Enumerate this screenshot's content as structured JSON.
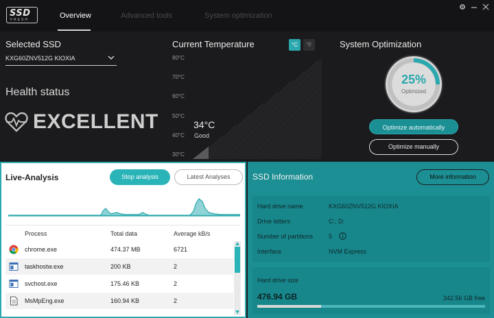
{
  "app": {
    "logo_main": "SSD",
    "logo_sub": "FRESH"
  },
  "tabs": [
    {
      "label": "Overview",
      "active": true
    },
    {
      "label": "Advanced tools",
      "active": false
    },
    {
      "label": "System optimization",
      "active": false
    }
  ],
  "window": {
    "icons": [
      "gear-icon",
      "minimize-icon",
      "close-icon"
    ]
  },
  "selected_ssd": {
    "title": "Selected SSD",
    "value": "KXG60ZNV512G KIOXIA"
  },
  "health": {
    "label": "Health status",
    "value": "EXCELLENT",
    "icon": "heartbeat-icon"
  },
  "temperature": {
    "title": "Current Temperature",
    "unit_c": "°C",
    "unit_f": "°F",
    "active_unit": "C",
    "ticks": [
      "80°C",
      "70°C",
      "60°C",
      "50°C",
      "40°C",
      "30°C"
    ],
    "value": "34°C",
    "status": "Good",
    "range": [
      30,
      80
    ],
    "level": 34
  },
  "optimization": {
    "title": "System Optimization",
    "percent_label": "25%",
    "percent": 25,
    "sub_label": "Optimized",
    "btn_auto": "Optimize automatically",
    "btn_manual": "Optimize manually"
  },
  "live": {
    "title": "Live-Analysis",
    "btn_stop": "Stop analysis",
    "btn_latest": "Latest Analyses",
    "columns": [
      "Process",
      "Total data",
      "Average kB/s"
    ],
    "rows": [
      {
        "icon": "chrome-icon",
        "process": "chrome.exe",
        "total": "474.37 MB",
        "avg": "6721"
      },
      {
        "icon": "app-window-icon",
        "process": "taskhostw.exe",
        "total": "200 KB",
        "avg": "2"
      },
      {
        "icon": "app-window-icon",
        "process": "svchost.exe",
        "total": "175.46 KB",
        "avg": "2"
      },
      {
        "icon": "document-icon",
        "process": "MsMpEng.exe",
        "total": "160.94 KB",
        "avg": "2"
      }
    ]
  },
  "info": {
    "title": "SSD Information",
    "btn_more": "More information",
    "fields": [
      {
        "key": "Hard drive name",
        "value": "KXG60ZNV512G KIOXIA"
      },
      {
        "key": "Drive letters",
        "value": "C:, D:"
      },
      {
        "key": "Number of partitions",
        "value": "5"
      },
      {
        "key": "Interface",
        "value": "NVM Express"
      }
    ],
    "size_label": "Hard drive size",
    "size_value": "476.94 GB",
    "free_value": "342.56 GB free",
    "used_fraction": 0.28
  },
  "colors": {
    "accent": "#2aa8ad",
    "panel_teal": "#1c8f94",
    "background": "#1b1b1d"
  }
}
